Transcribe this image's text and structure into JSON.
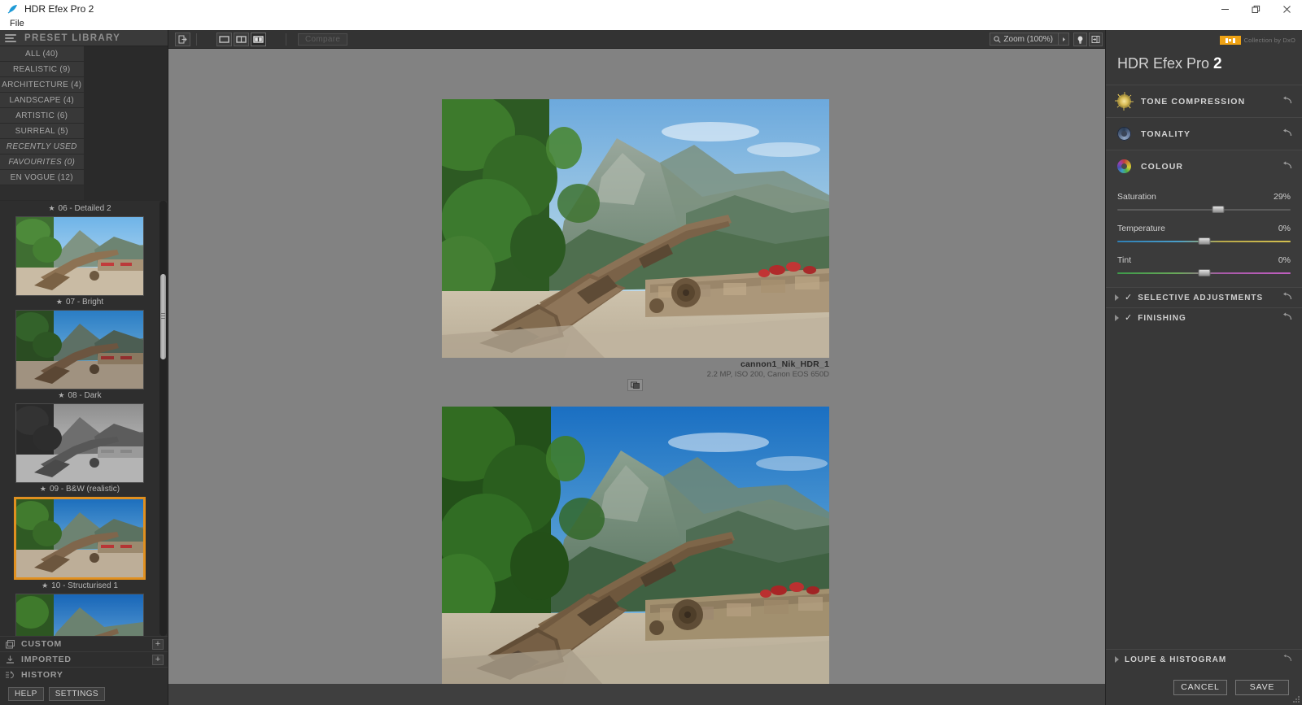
{
  "window": {
    "title": "HDR Efex Pro 2",
    "app_icon": "feather-icon",
    "minimize": "−",
    "maximize": "❐",
    "close": "✕"
  },
  "menubar": {
    "items": [
      {
        "label": "File"
      }
    ]
  },
  "preset_library": {
    "header_title": "PRESET LIBRARY",
    "menu_icon": "hamburger-icon",
    "categories": [
      {
        "label": "ALL (40)",
        "italic": false
      },
      {
        "label": "REALISTIC (9)",
        "italic": false
      },
      {
        "label": "ARCHITECTURE (4)",
        "italic": false
      },
      {
        "label": "LANDSCAPE (4)",
        "italic": false
      },
      {
        "label": "ARTISTIC (6)",
        "italic": false
      },
      {
        "label": "SURREAL (5)",
        "italic": false
      },
      {
        "label": "RECENTLY USED",
        "italic": true
      },
      {
        "label": "FAVOURITES (0)",
        "italic": true
      },
      {
        "label": "EN VOGUE (12)",
        "italic": false
      },
      {
        "label": "",
        "italic": false
      }
    ],
    "presets": [
      {
        "label": "06 - Detailed 2",
        "selected": false,
        "partial_top": true,
        "style": "detailed"
      },
      {
        "label": "07 - Bright",
        "selected": false,
        "style": "bright"
      },
      {
        "label": "08 - Dark",
        "selected": false,
        "style": "dark"
      },
      {
        "label": "09 - B&W (realistic)",
        "selected": false,
        "style": "bw"
      },
      {
        "label": "10 - Structurised 1",
        "selected": true,
        "style": "structurised"
      },
      {
        "label": "",
        "selected": false,
        "partial_bottom": true,
        "style": "vivid"
      }
    ],
    "sections": [
      {
        "label": "CUSTOM",
        "icon": "layers-icon",
        "has_plus": true,
        "plus_label": "+"
      },
      {
        "label": "IMPORTED",
        "icon": "import-icon",
        "has_plus": true,
        "plus_label": "+"
      },
      {
        "label": "HISTORY",
        "icon": "history-icon",
        "has_plus": false
      }
    ],
    "footer_buttons": [
      {
        "label": "HELP"
      },
      {
        "label": "SETTINGS"
      }
    ]
  },
  "toolbar": {
    "export_icon": "export-image-icon",
    "view_modes": [
      {
        "name": "single-view",
        "active": false
      },
      {
        "name": "split-view",
        "active": false
      },
      {
        "name": "side-by-side-view",
        "active": true
      }
    ],
    "compare_label": "Compare",
    "zoom": {
      "icon": "magnifier-icon",
      "label": "Zoom (100%)",
      "arrow": "▸"
    },
    "right_icons": [
      {
        "name": "brightness-icon"
      },
      {
        "name": "panel-toggle-icon"
      }
    ]
  },
  "canvas": {
    "top_image": {
      "caption_name": "cannon1_Nik_HDR_1",
      "caption_meta": "2.2 MP, ISO 200, Canon EOS 650D"
    },
    "divider_icon": "compare-swap-icon"
  },
  "right_panel": {
    "brand": {
      "logo_text": "nik",
      "tagline": "Collection by DxO",
      "logo_color": "#eea215"
    },
    "app_title": "HDR Efex Pro",
    "app_version": "2",
    "sections": [
      {
        "label": "TONE COMPRESSION",
        "icon": "sun-icon",
        "reset_icon": "reset-arrow-icon",
        "open": false
      },
      {
        "label": "TONALITY",
        "icon": "aperture-icon",
        "reset_icon": "reset-arrow-icon",
        "open": false
      },
      {
        "label": "COLOUR",
        "icon": "colour-wheel-icon",
        "reset_icon": "reset-arrow-icon",
        "open": true
      }
    ],
    "colour_sliders": [
      {
        "name": "Saturation",
        "value": "29%",
        "pos": 58,
        "track": "plain"
      },
      {
        "name": "Temperature",
        "value": "0%",
        "pos": 50,
        "track": "temp"
      },
      {
        "name": "Tint",
        "value": "0%",
        "pos": 50,
        "track": "tint"
      }
    ],
    "subsections": [
      {
        "label": "SELECTIVE ADJUSTMENTS",
        "checked": true,
        "check": "✓",
        "reset_icon": "reset-arrow-icon"
      },
      {
        "label": "FINISHING",
        "checked": true,
        "check": "✓",
        "reset_icon": "reset-arrow-icon"
      }
    ],
    "loupe": {
      "label": "LOUPE & HISTOGRAM",
      "reset_icon": "reset-arrow-icon"
    },
    "actions": [
      {
        "label": "CANCEL",
        "name": "cancel-button"
      },
      {
        "label": "SAVE",
        "name": "save-button"
      }
    ]
  }
}
